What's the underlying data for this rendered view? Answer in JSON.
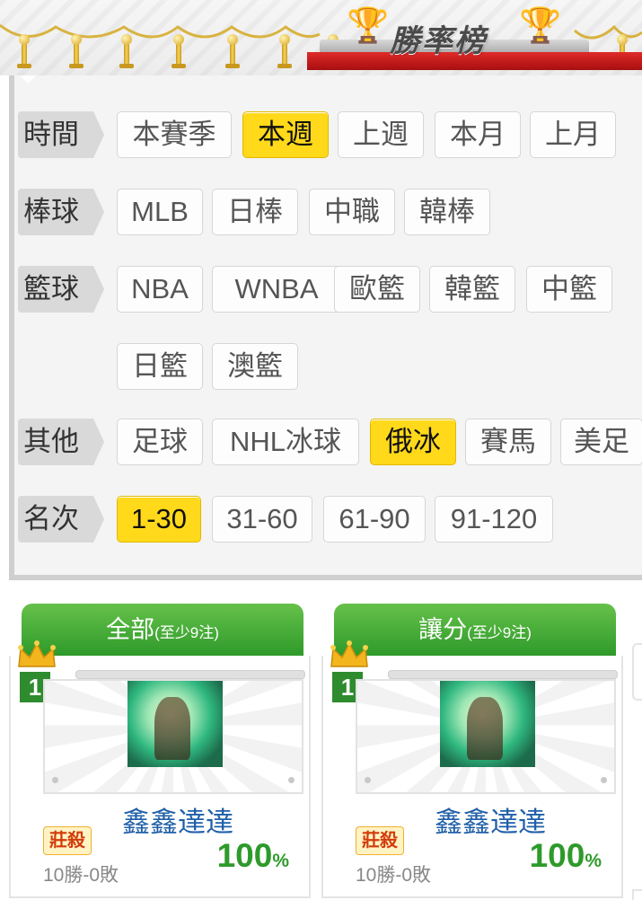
{
  "header": {
    "title": "勝率榜"
  },
  "filters": {
    "time": {
      "label": "時間",
      "options": [
        "本賽季",
        "本週",
        "上週",
        "本月",
        "上月"
      ],
      "selected": "本週"
    },
    "baseball": {
      "label": "棒球",
      "options": [
        "MLB",
        "日棒",
        "中職",
        "韓棒"
      ]
    },
    "basketball": {
      "label": "籃球",
      "options": [
        "NBA",
        "WNBA",
        "歐籃",
        "韓籃",
        "中籃",
        "日籃",
        "澳籃"
      ]
    },
    "other": {
      "label": "其他",
      "options": [
        "足球",
        "NHL冰球",
        "俄冰",
        "賽馬",
        "美足"
      ],
      "selected": "俄冰"
    },
    "rank": {
      "label": "名次",
      "options": [
        "1-30",
        "31-60",
        "61-90",
        "91-120"
      ],
      "selected": "1-30"
    }
  },
  "cards": [
    {
      "title": "全部",
      "subtitle": "(至少9注)",
      "rank": "1",
      "player": "鑫鑫達達",
      "tag": "莊殺",
      "record": "10勝-0敗",
      "percent": "100",
      "percent_unit": "%"
    },
    {
      "title": "讓分",
      "subtitle": "(至少9注)",
      "rank": "1",
      "player": "鑫鑫達達",
      "tag": "莊殺",
      "record": "10勝-0敗",
      "percent": "100",
      "percent_unit": "%"
    }
  ],
  "colors": {
    "active_chip": "#ffd91a",
    "card_header": "#3aa534",
    "player_name": "#1f5fa8",
    "percent": "#2e9a2a",
    "rank_badge": "#2e8b2e"
  },
  "icons": {
    "trophy": "trophy-icon",
    "crown": "crown-icon"
  }
}
